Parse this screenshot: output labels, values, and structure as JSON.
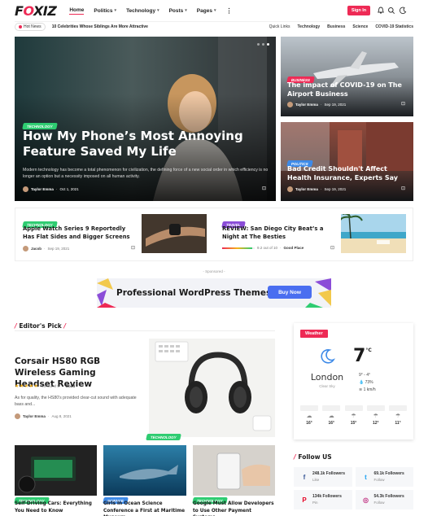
{
  "header": {
    "logo": "FOXIZ",
    "nav": [
      {
        "label": "Home",
        "caret": false
      },
      {
        "label": "Politics",
        "caret": true
      },
      {
        "label": "Technology",
        "caret": true
      },
      {
        "label": "Posts",
        "caret": true
      },
      {
        "label": "Pages",
        "caret": true
      }
    ],
    "signin": "Sign In"
  },
  "trending": {
    "badge": "Hot News",
    "headline": "10 Celebrities Whose Siblings Are More Attractive",
    "quicklinks_label": "Quick Links",
    "quicklinks": [
      "Technology",
      "Business",
      "Science",
      "COVID-19 Statistics"
    ]
  },
  "hero": {
    "tag": "Technology",
    "title": "How My Phone’s Most Annoying Feature Saved My Life",
    "excerpt": "Modern technology has become a total phenomenon for civilization, the defining force of a new social order in which efficiency is no longer an option but a necessity imposed on all human activity.",
    "author": "Taylor Emma",
    "date": "Oct 1, 2021"
  },
  "side1": {
    "tag": "Business",
    "title": "The impact of COVID-19 on The Airport Business",
    "author": "Taylor Emma",
    "date": "Sep 19, 2021"
  },
  "side2": {
    "tag": "Politics",
    "title": "Bad Credit Shouldn't Affect Health Insurance, Experts Say",
    "author": "Taylor Emma",
    "date": "Sep 19, 2021"
  },
  "row": {
    "left": {
      "tag": "Technology",
      "title": "Apple Watch Series 9 Reportedly Has Flat Sides and Bigger Screens",
      "author": "Jacob",
      "date": "Sep 19, 2021"
    },
    "right": {
      "tag": "Travel",
      "title": "REVIEW: San Diego City Beat’s a Night at The Besties",
      "score": "9.2 out of 10",
      "score_value": 9.2,
      "verdict": "Good Place"
    }
  },
  "ad": {
    "sponsored": "- Sponsored -",
    "title": "Professional WordPress Themes",
    "button": "Buy Now"
  },
  "editors_pick": {
    "heading": "Editor's Pick",
    "title": "Corsair HS80 RGB Wireless Gaming Headset Review",
    "rating_text": "4.8 out of 5",
    "rating_value": 4.8,
    "verdict": "Good",
    "excerpt": "As for quality, the HS80's provided clear-cut sound with adequate bass and...",
    "author": "Taylor Emma",
    "date": "Aug 8, 2021",
    "image_tag": "Technology"
  },
  "grid": [
    {
      "tag": "Technology",
      "title": "Self-Driving Cars: Everything You Need to Know"
    },
    {
      "tag": "Science",
      "title": "Girls in Ocean Science Conference a First at Maritime Museum"
    },
    {
      "tag": "Technology",
      "title": "Google Must Allow Developers to Use Other Payment Systems"
    }
  ],
  "weather": {
    "label": "Weather",
    "temp": "7",
    "unit": "°C",
    "city": "London",
    "sky": "Clear Sky",
    "range": "9° - 4°",
    "humidity": "73%",
    "wind": "1 km/h",
    "days": [
      {
        "temp": "16°"
      },
      {
        "temp": "16°"
      },
      {
        "temp": "15°"
      },
      {
        "temp": "12°"
      },
      {
        "temp": "11°"
      }
    ]
  },
  "follow": {
    "heading": "Follow US",
    "items": [
      {
        "icon": "facebook-icon",
        "glyph": "f",
        "color": "#3b5998",
        "count": "248.1k Followers",
        "label": "Like"
      },
      {
        "icon": "twitter-icon",
        "glyph": "t",
        "color": "#1da1f2",
        "count": "69.1k Followers",
        "label": "Follow"
      },
      {
        "icon": "pinterest-icon",
        "glyph": "P",
        "color": "#e60023",
        "count": "134k Followers",
        "label": "Pin"
      },
      {
        "icon": "instagram-icon",
        "glyph": "◎",
        "color": "#c13584",
        "count": "54.3k Followers",
        "label": "Follow"
      }
    ]
  }
}
